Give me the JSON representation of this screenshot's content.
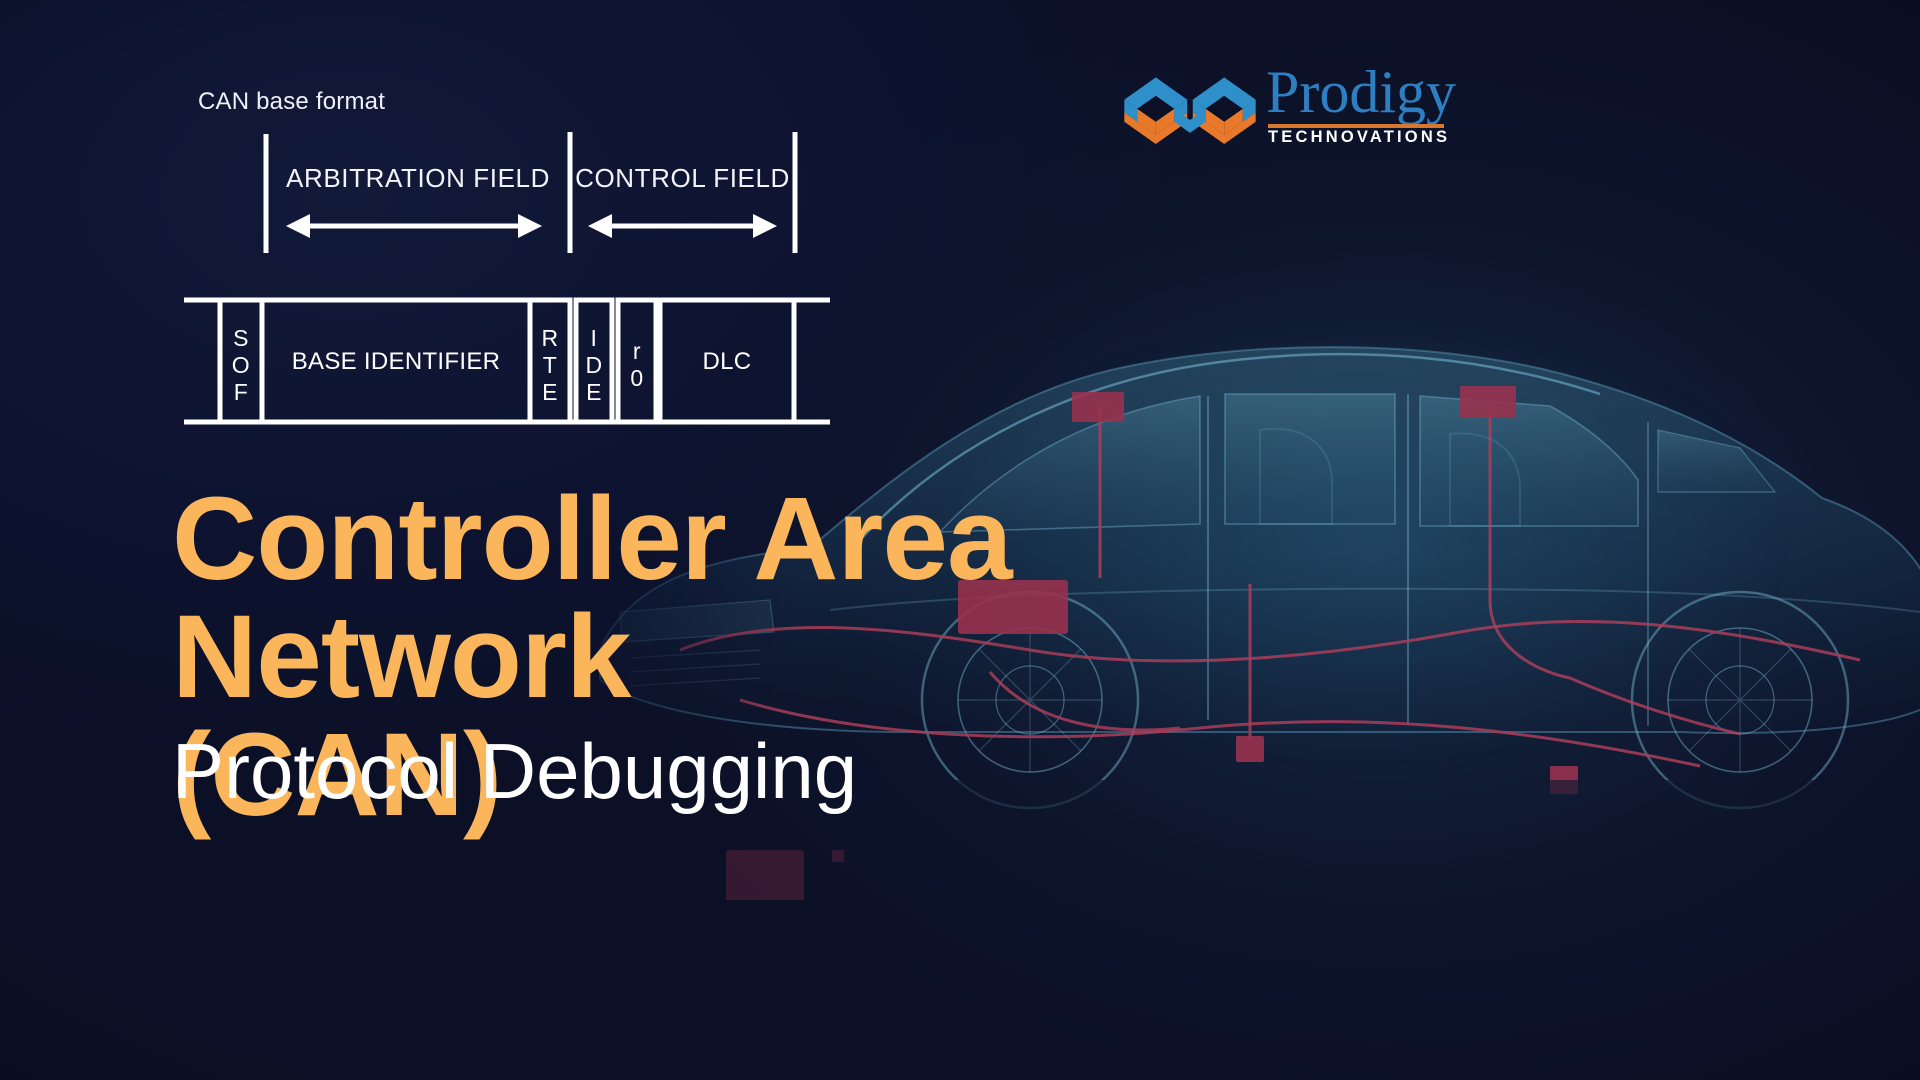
{
  "theme": {
    "background": "#0b1026",
    "accent_orange": "#fbb65c",
    "logo_blue": "#2e7fc1",
    "logo_orange": "#e07b2c",
    "stroke_white": "#ffffff",
    "car_teal": "#2f7f9e",
    "car_red": "#a83a55"
  },
  "diagram": {
    "caption": "CAN base format",
    "fields": [
      {
        "label": "ARBITRATION FIELD"
      },
      {
        "label": "CONTROL FIELD"
      }
    ],
    "boxes": [
      {
        "label": "S\nO\nF",
        "name": "sof"
      },
      {
        "label": "BASE IDENTIFIER",
        "name": "base-identifier"
      },
      {
        "label": "R\nT\nE",
        "name": "rte"
      },
      {
        "label": "I\nD\nE",
        "name": "ide"
      },
      {
        "label": "r\n0",
        "name": "r0"
      },
      {
        "label": "DLC",
        "name": "dlc"
      }
    ]
  },
  "logo": {
    "brand": "Prodigy",
    "tagline": "TECHNOVATIONS",
    "mark_name": "prodigy-infinity-mark"
  },
  "hero": {
    "title_line1": "Controller Area Network",
    "title_line2": "(CAN)",
    "subtitle": "Protocol Debugging"
  },
  "artwork": {
    "name": "xray-car-wiring-harness"
  }
}
